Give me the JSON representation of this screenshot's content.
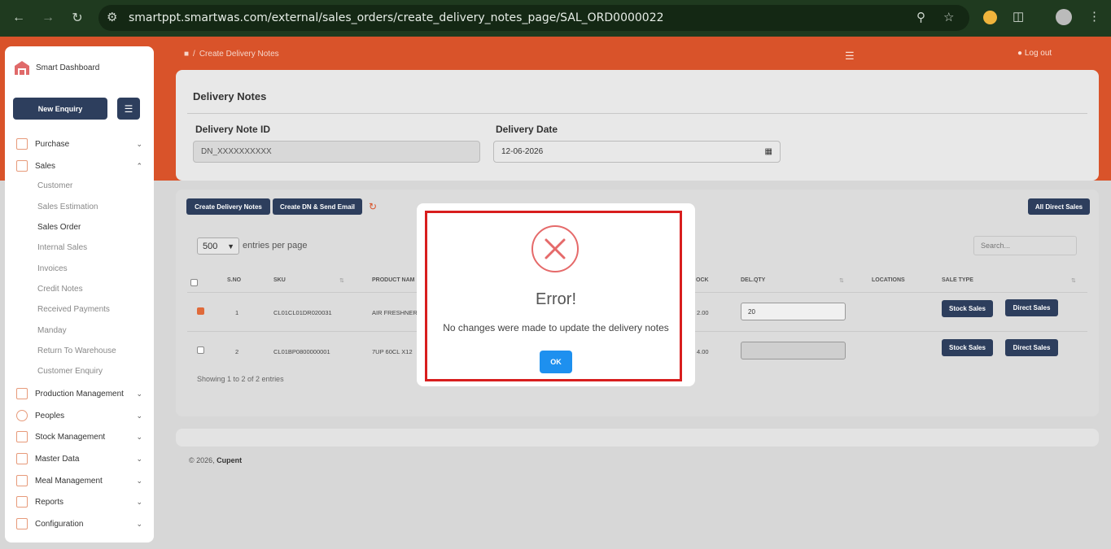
{
  "browser": {
    "url": "smartppt.smartwas.com/external/sales_orders/create_delivery_notes_page/SAL_ORD0000022"
  },
  "sidebar": {
    "brand": "Smart Dashboard",
    "new_enquiry": "New Enquiry",
    "items": [
      {
        "label": "Purchase",
        "icon": "cart-icon"
      },
      {
        "label": "Sales",
        "icon": "sales-icon"
      },
      {
        "label": "Production Management",
        "icon": "factory-icon"
      },
      {
        "label": "Peoples",
        "icon": "people-icon"
      },
      {
        "label": "Stock Management",
        "icon": "stock-icon"
      },
      {
        "label": "Master Data",
        "icon": "database-icon"
      },
      {
        "label": "Meal Management",
        "icon": "meal-icon"
      },
      {
        "label": "Reports",
        "icon": "report-icon"
      },
      {
        "label": "Configuration",
        "icon": "config-icon"
      }
    ],
    "sales_sub": [
      "Customer",
      "Sales Estimation",
      "Sales Order",
      "Internal Sales",
      "Invoices",
      "Credit Notes",
      "Received Payments",
      "Manday",
      "Return To Warehouse",
      "Customer Enquiry"
    ]
  },
  "header": {
    "breadcrumb": "Create Delivery Notes",
    "logout": "Log out"
  },
  "form": {
    "title": "Delivery Notes",
    "id_label": "Delivery Note ID",
    "id_value": "DN_XXXXXXXXXX",
    "date_label": "Delivery Date",
    "date_value": "12-06-2026"
  },
  "toolbar": {
    "create_dn": "Create Delivery Notes",
    "create_send": "Create DN & Send Email",
    "all_direct": "All Direct Sales",
    "per_page": "500",
    "per_page_label": "entries per page",
    "search_placeholder": "Search..."
  },
  "table": {
    "headers": [
      "S.NO",
      "SKU",
      "PRODUCT NAM",
      "OCK",
      "DEL.QTY",
      "LOCATIONS",
      "SALE TYPE"
    ],
    "rows": [
      {
        "sno": "1",
        "sku": "CL01CL01DR020031",
        "product": "AIR FRESHNER",
        "stock": "2.00",
        "qty": "20",
        "checked": true
      },
      {
        "sno": "2",
        "sku": "CL01BP0800000001",
        "product": "7UP 60CL X12",
        "stock": "4.00",
        "qty": "",
        "checked": false
      }
    ],
    "stock_sales": "Stock Sales",
    "direct_sales": "Direct Sales",
    "showing": "Showing 1 to 2 of 2 entries"
  },
  "footer": {
    "year": "© 2026,",
    "company": "Cupent"
  },
  "modal": {
    "title": "Error!",
    "message": "No changes were made to update the delivery notes",
    "ok": "OK"
  },
  "colors": {
    "accent": "#d9532a",
    "dark": "#2d3e5d",
    "error": "#d81e1e",
    "ok": "#1e90ef"
  }
}
